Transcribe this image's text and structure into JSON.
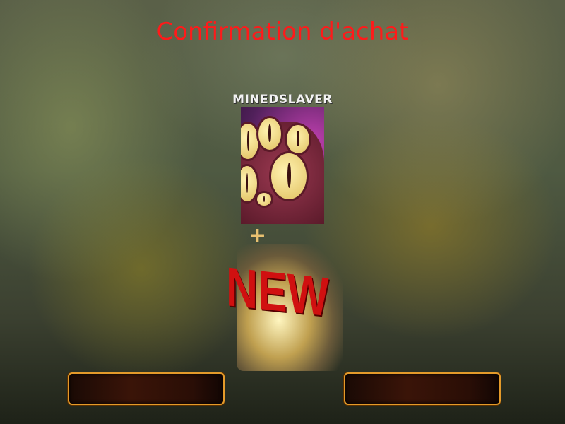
{
  "dialog": {
    "title": "Confirmation d'achat"
  },
  "reward": {
    "character_name": "MINEDSLAVER",
    "plus_symbol": "+",
    "badge_text": "NEW"
  },
  "buttons": {
    "left_label": "",
    "right_label": ""
  },
  "colors": {
    "title": "#ff1a1a",
    "button_border": "#e49a2a"
  }
}
